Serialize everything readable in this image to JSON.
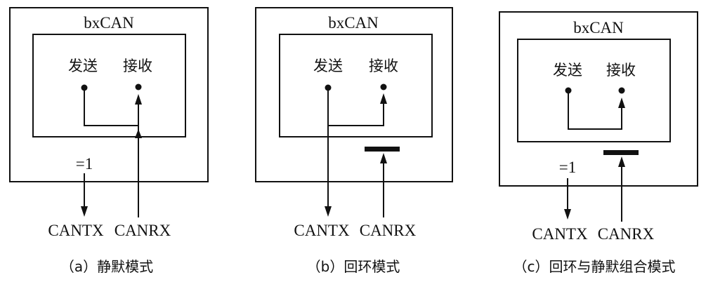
{
  "panels": [
    {
      "block_title": "bxCAN",
      "send_label": "发送",
      "receive_label": "接收",
      "tx_gate_label": "=1",
      "tx_pin": "CANTX",
      "rx_pin": "CANRX",
      "caption": "（a）静默模式"
    },
    {
      "block_title": "bxCAN",
      "send_label": "发送",
      "receive_label": "接收",
      "tx_pin": "CANTX",
      "rx_pin": "CANRX",
      "caption": "（b）回环模式"
    },
    {
      "block_title": "bxCAN",
      "send_label": "发送",
      "receive_label": "接收",
      "tx_gate_label": "=1",
      "tx_pin": "CANTX",
      "rx_pin": "CANRX",
      "caption": "（c）回环与静默组合模式"
    }
  ]
}
